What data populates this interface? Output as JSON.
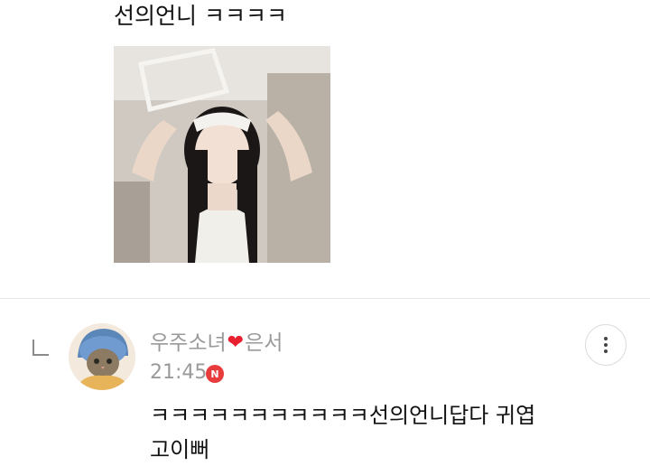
{
  "top_comment": {
    "text": "선의언니 ㅋㅋㅋㅋ",
    "photo": "attached-photo-girl-headband"
  },
  "reply": {
    "author_name_part1": "우주소녀",
    "author_heart": "❤",
    "author_name_part2": "은서",
    "time": "21:45",
    "new_badge": "N",
    "text_line1": "ㅋㅋㅋㅋㅋㅋㅋㅋㅋㅋㅋ선의언니답다 귀엽",
    "text_line2": "고이뻐",
    "icons": {
      "reply_marker": "reply-arrow-icon",
      "more": "more-vertical-icon"
    }
  },
  "colors": {
    "meta_text": "#9a9a9a",
    "heart": "#e8202f",
    "new_badge": "#e83c3c",
    "divider": "#e6e6e6"
  }
}
